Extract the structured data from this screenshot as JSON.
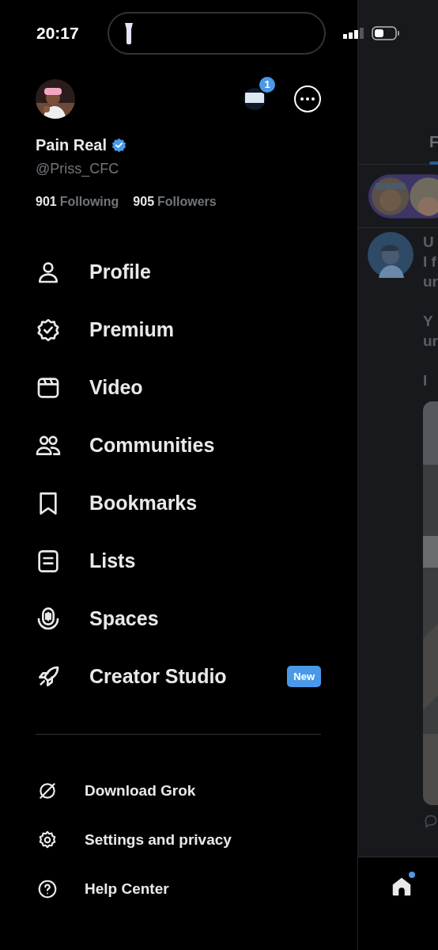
{
  "status_bar": {
    "time": "20:17"
  },
  "account": {
    "name": "Pain Real",
    "verified": true,
    "handle": "@Priss_CFC",
    "following_count": "901",
    "following_label": "Following",
    "followers_count": "905",
    "followers_label": "Followers",
    "notification_badge": "1"
  },
  "menu": [
    {
      "kind": "person",
      "label": "Profile"
    },
    {
      "kind": "badge",
      "label": "Premium"
    },
    {
      "kind": "video",
      "label": "Video"
    },
    {
      "kind": "people",
      "label": "Communities"
    },
    {
      "kind": "bookmark",
      "label": "Bookmarks"
    },
    {
      "kind": "list",
      "label": "Lists"
    },
    {
      "kind": "mic",
      "label": "Spaces"
    },
    {
      "kind": "rocket",
      "label": "Creator Studio",
      "badge": "New"
    }
  ],
  "footer_menu": [
    {
      "kind": "slash",
      "label": "Download Grok"
    },
    {
      "kind": "gear",
      "label": "Settings and privacy"
    },
    {
      "kind": "help",
      "label": "Help Center"
    }
  ],
  "timeline": {
    "tab": "F",
    "author": "U",
    "paragraphs": [
      [
        "I f",
        "ur"
      ],
      [
        "Y",
        "ur"
      ],
      [
        "I"
      ]
    ],
    "home_unread": true
  }
}
